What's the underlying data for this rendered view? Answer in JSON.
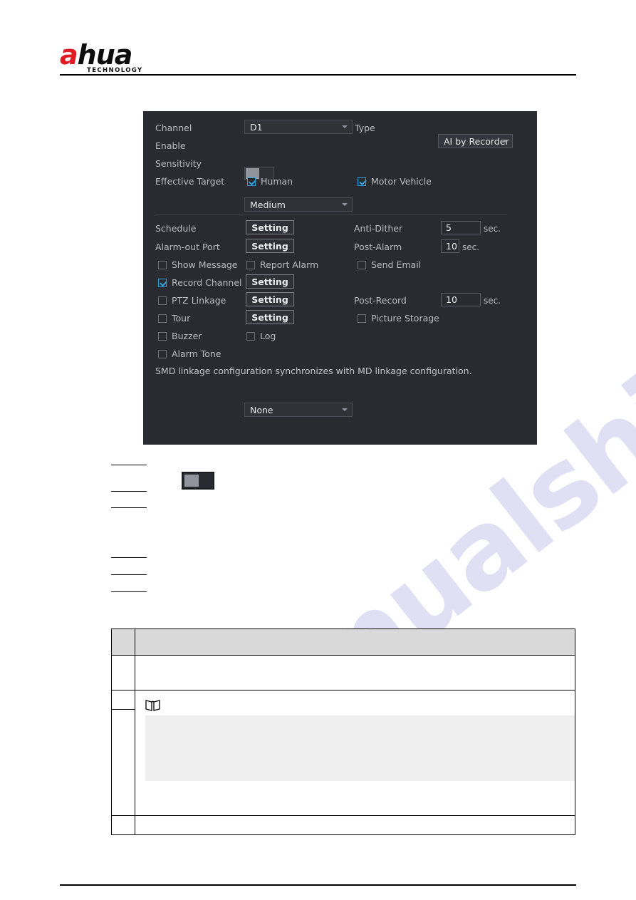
{
  "brand": {
    "logo_a": "a",
    "logo_rest": "hua",
    "logo_sub": "TECHNOLOGY"
  },
  "dialog": {
    "fields": {
      "channel_label": "Channel",
      "channel_value": "D1",
      "type_label": "Type",
      "type_value": "AI by Recorder",
      "enable_label": "Enable",
      "sensitivity_label": "Sensitivity",
      "sensitivity_value": "Medium",
      "effective_target_label": "Effective Target",
      "human_label": "Human",
      "motor_vehicle_label": "Motor Vehicle"
    },
    "linkage": {
      "schedule_label": "Schedule",
      "schedule_button": "Setting",
      "anti_dither_label": "Anti-Dither",
      "anti_dither_value": "5",
      "anti_dither_unit": "sec.",
      "alarm_out_label": "Alarm-out Port",
      "alarm_out_button": "Setting",
      "post_alarm_label": "Post-Alarm",
      "post_alarm_value": "10",
      "post_alarm_unit": "sec.",
      "show_message_label": "Show Message",
      "report_alarm_label": "Report Alarm",
      "send_email_label": "Send Email",
      "record_channel_label": "Record Channel",
      "record_channel_button": "Setting",
      "ptz_linkage_label": "PTZ Linkage",
      "ptz_linkage_button": "Setting",
      "post_record_label": "Post-Record",
      "post_record_value": "10",
      "post_record_unit": "sec.",
      "tour_label": "Tour",
      "tour_button": "Setting",
      "picture_storage_label": "Picture Storage",
      "buzzer_label": "Buzzer",
      "log_label": "Log",
      "alarm_tone_label": "Alarm Tone",
      "alarm_tone_value": "None"
    },
    "footer_note": "SMD linkage configuration synchronizes with MD linkage configuration."
  },
  "table": {
    "header": [
      "",
      ""
    ],
    "rows": [
      {
        "c1": "",
        "c2": ""
      },
      {
        "c1": "",
        "c2": ""
      },
      {
        "c1": "",
        "c2": ""
      },
      {
        "c1": "",
        "c2": ""
      }
    ]
  },
  "watermark": {
    "text": "manualshive.com"
  },
  "colors": {
    "dialog_bg": "#2a2b30",
    "accent_blue": "#2aa3e0",
    "brand_red": "#e01b24",
    "table_header": "#d9d9d9"
  }
}
